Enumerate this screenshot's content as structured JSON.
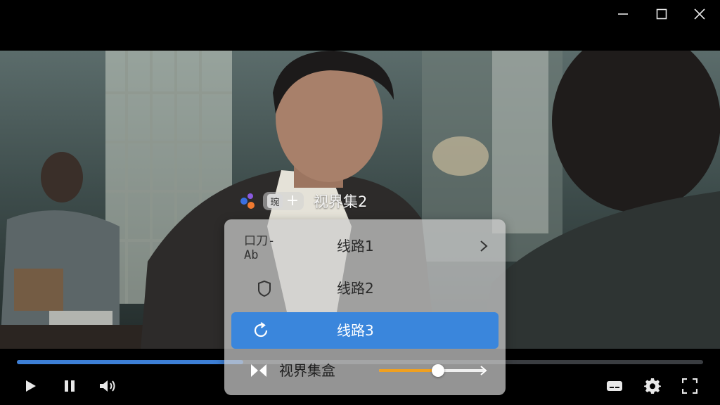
{
  "window": {
    "controls": [
      "minimize-icon",
      "maximize-icon",
      "close-icon"
    ]
  },
  "app_tag": {
    "glyph": "琬",
    "plus": "+",
    "name": "视界集2"
  },
  "menu": {
    "items": [
      {
        "icon_text": "口刀-Ab",
        "label": "线路1",
        "has_submenu": true,
        "active": false
      },
      {
        "icon": "shield-icon",
        "label": "线路2",
        "has_submenu": false,
        "active": false
      },
      {
        "icon": "refresh-icon",
        "label": "线路3",
        "has_submenu": false,
        "active": true
      }
    ],
    "footer": {
      "label": "视界集盒",
      "slider_value": 0.56,
      "slider_color": "#f0a020"
    }
  },
  "player": {
    "progress": 0.33,
    "progress_color": "#3d7fd6",
    "left_controls": [
      "play-icon",
      "pause-icon",
      "volume-icon"
    ],
    "right_controls": [
      "subtitle-icon",
      "settings-gear-icon",
      "fullscreen-icon"
    ]
  },
  "colors": {
    "accent": "#3a86dc",
    "background": "#000000"
  }
}
